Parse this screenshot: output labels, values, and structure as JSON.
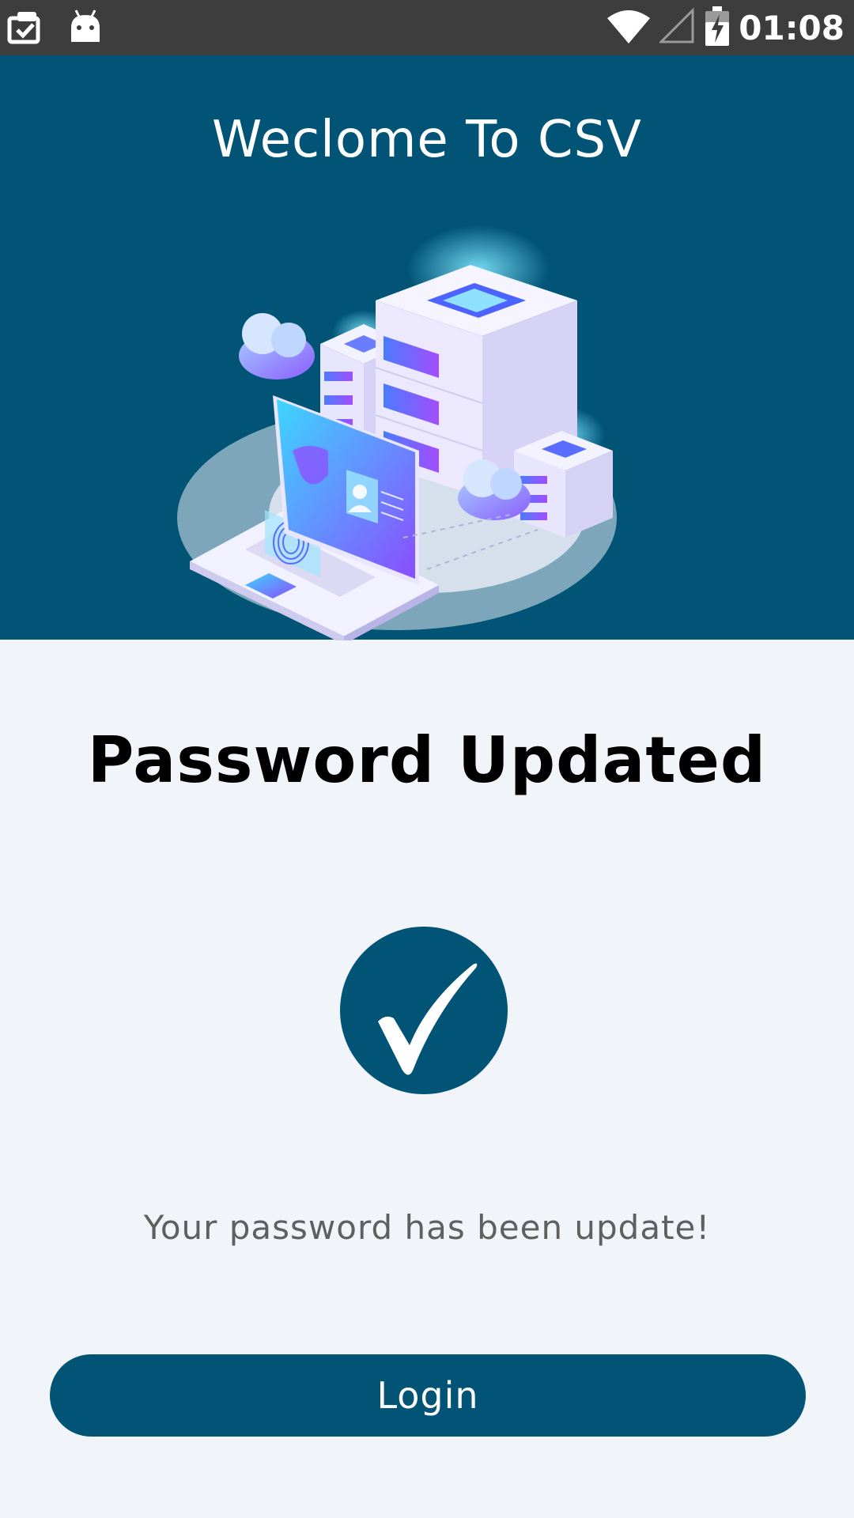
{
  "status_bar": {
    "time": "01:08",
    "left_icons": [
      "clipboard-check-icon",
      "android-icon"
    ],
    "right_icons": [
      "wifi-icon",
      "cell-signal-icon",
      "battery-charging-icon"
    ]
  },
  "header": {
    "title": "Weclome To CSV",
    "background_color": "#015476",
    "illustration": "server-cloud-security-illustration"
  },
  "result": {
    "title": "Password Updated",
    "icon": "checkmark-circle-icon",
    "message": "Your password has been update!"
  },
  "actions": {
    "login_label": "Login"
  },
  "colors": {
    "primary": "#015476",
    "page_background": "#f1f4f8",
    "status_bar": "#3d3d3d",
    "message_text": "#5f5f5f"
  }
}
